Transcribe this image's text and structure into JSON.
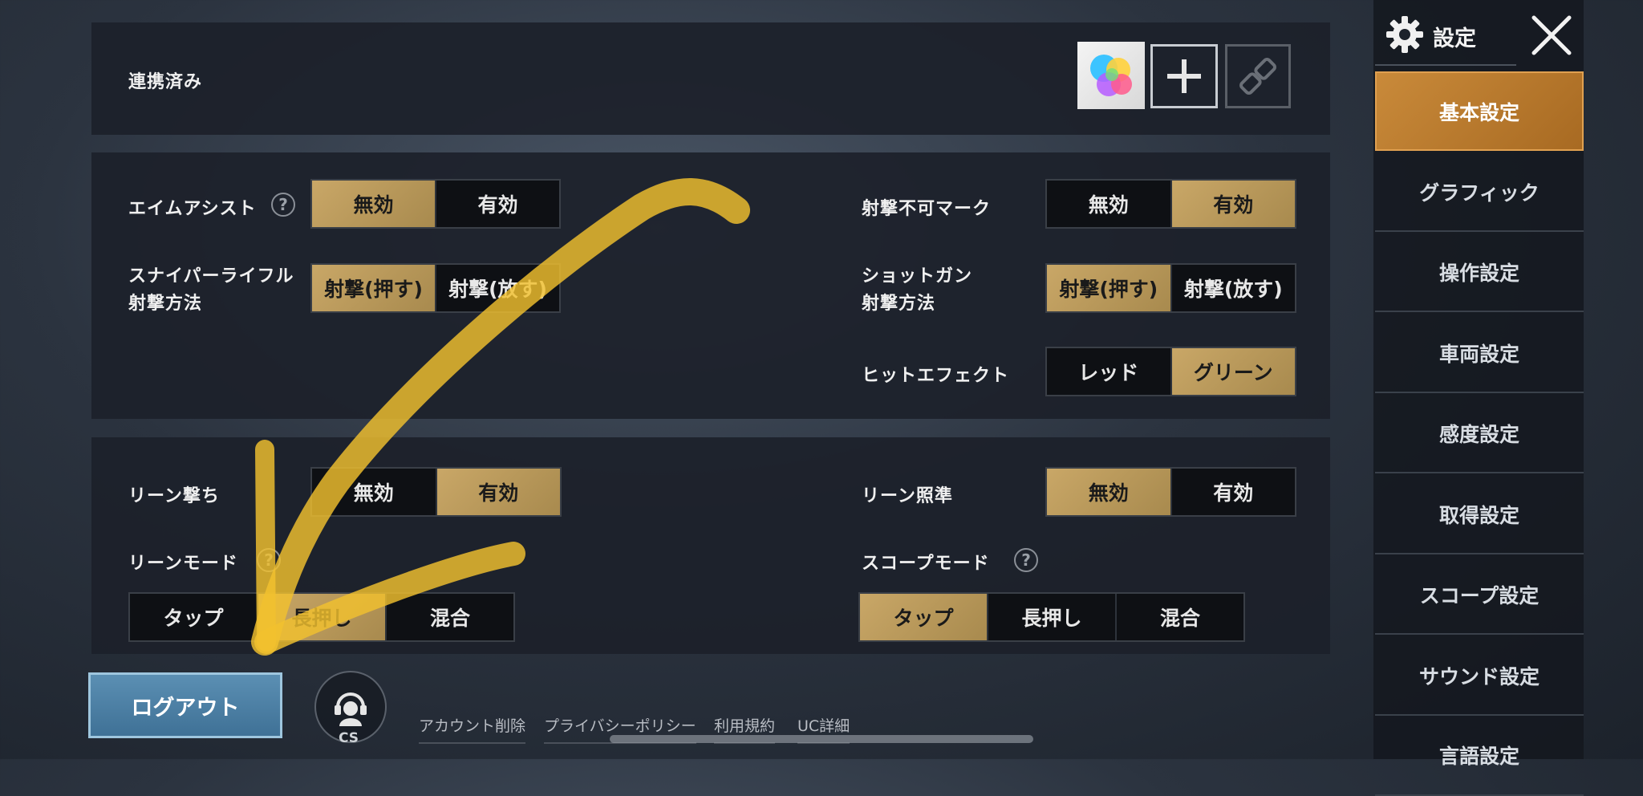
{
  "linked": {
    "label": "連携済み"
  },
  "section1": {
    "aim_assist": {
      "label": "エイムアシスト",
      "help": "?",
      "options": [
        "無効",
        "有効"
      ]
    },
    "no_shoot_mark": {
      "label": "射撃不可マーク",
      "options": [
        "無効",
        "有効"
      ]
    },
    "sniper": {
      "label1": "スナイパーライフル",
      "label2": "射撃方法",
      "options": [
        "射撃(押す)",
        "射撃(放す)"
      ]
    },
    "shotgun": {
      "label1": "ショットガン",
      "label2": "射撃方法",
      "options": [
        "射撃(押す)",
        "射撃(放す)"
      ]
    },
    "hit_effect": {
      "label": "ヒットエフェクト",
      "options": [
        "レッド",
        "グリーン"
      ]
    }
  },
  "section2": {
    "lean_fire": {
      "label": "リーン撃ち",
      "options": [
        "無効",
        "有効"
      ]
    },
    "lean_aim": {
      "label": "リーン照準",
      "options": [
        "無効",
        "有効"
      ]
    },
    "lean_mode": {
      "label": "リーンモード",
      "help": "?",
      "options": [
        "タップ",
        "長押し",
        "混合"
      ]
    },
    "scope_mode": {
      "label": "スコープモード",
      "help": "?",
      "options": [
        "タップ",
        "長押し",
        "混合"
      ]
    }
  },
  "footer": {
    "logout": "ログアウト",
    "cs_label": "CS",
    "links": [
      "アカウント削除",
      "プライバシーポリシー",
      "利用規約",
      "UC詳細"
    ]
  },
  "sidebar": {
    "title": "設定",
    "items": [
      "基本設定",
      "グラフィック",
      "操作設定",
      "車両設定",
      "感度設定",
      "取得設定",
      "スコープ設定",
      "サウンド設定",
      "言語設定"
    ]
  },
  "colors": {
    "gold": "#c9a767",
    "orange_active": "#c98a3a",
    "logout_blue": "#4a7fa3",
    "annotation_yellow": "#f2c12e"
  },
  "icons": [
    "gear-icon",
    "close-icon",
    "game-center-icon",
    "plus-icon",
    "link-icon",
    "help-icon",
    "customer-service-icon"
  ]
}
